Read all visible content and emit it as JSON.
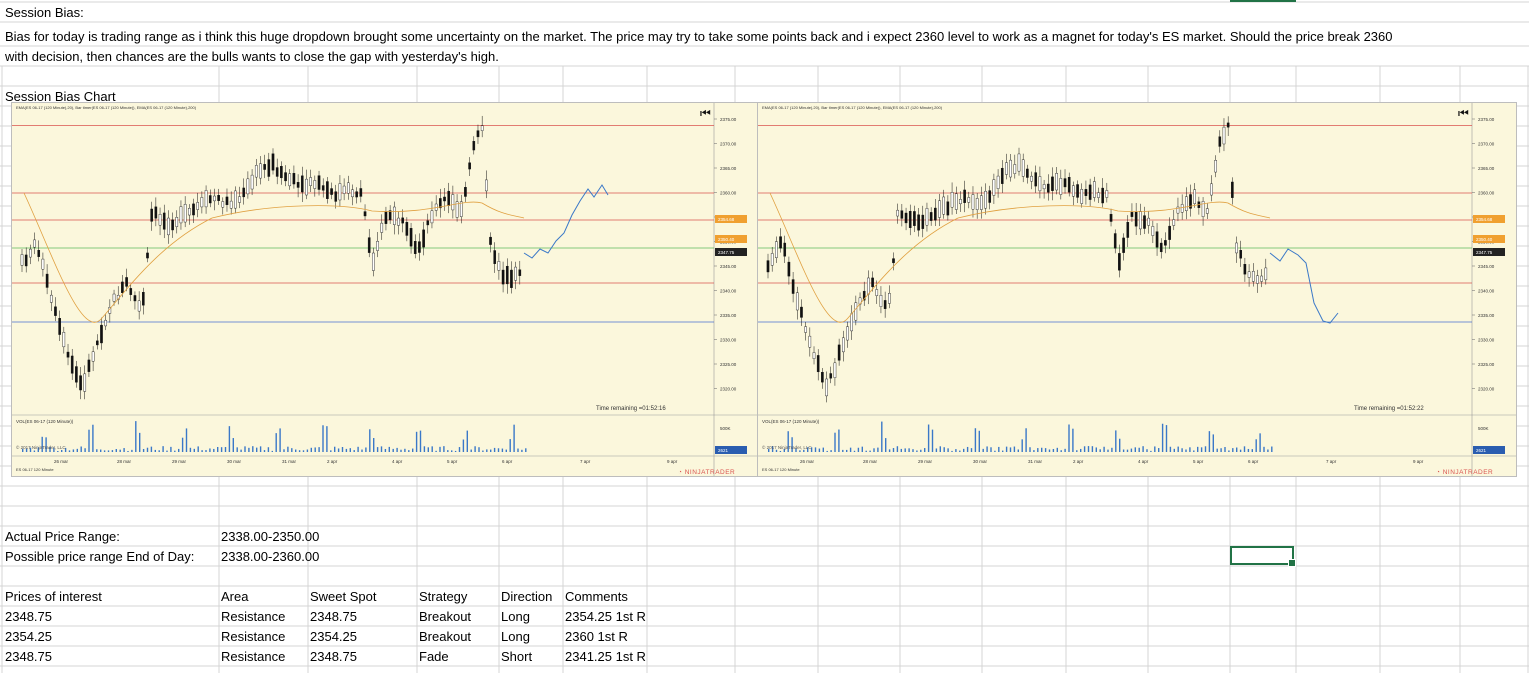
{
  "sheet": {
    "session_bias_label": "Session Bias:",
    "bias_text_line1": "Bias for today is trading range as i think this huge dropdown brought some uncertainty on the market. The price may try to take some points back and i expect 2360 level to work as a magnet for today's ES market. Should the price break 2360",
    "bias_text_line2": "with decision, then chances are  the bulls wants to close the gap with yesterday's high.",
    "chart_label": "Session Bias Chart",
    "actual_range_label": "Actual Price Range:",
    "actual_range_value": "2338.00-2350.00",
    "possible_range_label": "Possible price range End of Day:",
    "possible_range_value": "2338.00-2360.00",
    "table": {
      "headers": [
        "Prices of interest",
        "Area",
        "Sweet Spot",
        "Strategy",
        "Direction",
        "Comments"
      ],
      "rows": [
        [
          "2348.75",
          "Resistance",
          "2348.75",
          "Breakout",
          "Long",
          "2354.25 1st R"
        ],
        [
          "2354.25",
          "Resistance",
          "2354.25",
          "Breakout",
          "Long",
          "2360 1st R"
        ],
        [
          "2348.75",
          "Resistance",
          "2348.75",
          "Fade",
          "Short",
          "2341.25 1st R"
        ]
      ]
    }
  },
  "charts": [
    {
      "header": "EMA(ES 06-17 (120 Minute),20), Bar timer(ES 06-17 (120 Minute)), EMA(ES 06-17 (120 Minute),200)",
      "time_remaining": "Time remaining =01:52:16",
      "vol_label": "VOL(ES 06-17 (120 Minute))",
      "copyright": "© 2017 NinjaTrader, LLC",
      "instrument": "ES 06-17 120 Minute",
      "brand": "NINJATRADER",
      "vol_axis": "500K",
      "vol_last": "2621",
      "axis_labels": [
        "2375.00",
        "2370.00",
        "2365.00",
        "2360.00",
        "2355.00",
        "2350.00",
        "2345.00",
        "2340.00",
        "2335.00",
        "2330.00",
        "2325.00",
        "2320.00"
      ],
      "badges": [
        "2354.68",
        "2350.40",
        "2347.75"
      ],
      "dates": [
        "26 mar",
        "28 mar",
        "29 mar",
        "30 mar",
        "31 mar",
        "2 apr",
        "4 apr",
        "5 apr",
        "6 apr",
        "7 apr",
        "9 apr"
      ]
    },
    {
      "header": "EMA(ES 06-17 (120 Minute),20), Bar timer(ES 06-17 (120 Minute)), EMA(ES 06-17 (120 Minute),200)",
      "time_remaining": "Time remaining =01:52:22",
      "vol_label": "VOL(ES 06-17 (120 Minute))",
      "copyright": "© 2017 NinjaTrader, LLC",
      "instrument": "ES 06-17 120 Minute",
      "brand": "NINJATRADER",
      "vol_axis": "500K",
      "vol_last": "2621",
      "axis_labels": [
        "2375.00",
        "2370.00",
        "2365.00",
        "2360.00",
        "2355.00",
        "2350.00",
        "2345.00",
        "2340.00",
        "2335.00",
        "2330.00",
        "2325.00",
        "2320.00"
      ],
      "badges": [
        "2354.68",
        "2350.40",
        "2347.75"
      ],
      "dates": [
        "26 mar",
        "28 mar",
        "29 mar",
        "30 mar",
        "31 mar",
        "2 apr",
        "4 apr",
        "5 apr",
        "6 apr",
        "7 apr",
        "9 apr"
      ]
    }
  ],
  "colors": {
    "chart_bg": "#fbf7dc",
    "red_level": "#d9534f",
    "green_level": "#5cb85c",
    "blue_level": "#4a6fd0",
    "ema": "#e0a040",
    "badge": "#f0a030",
    "selection": "#217346"
  }
}
